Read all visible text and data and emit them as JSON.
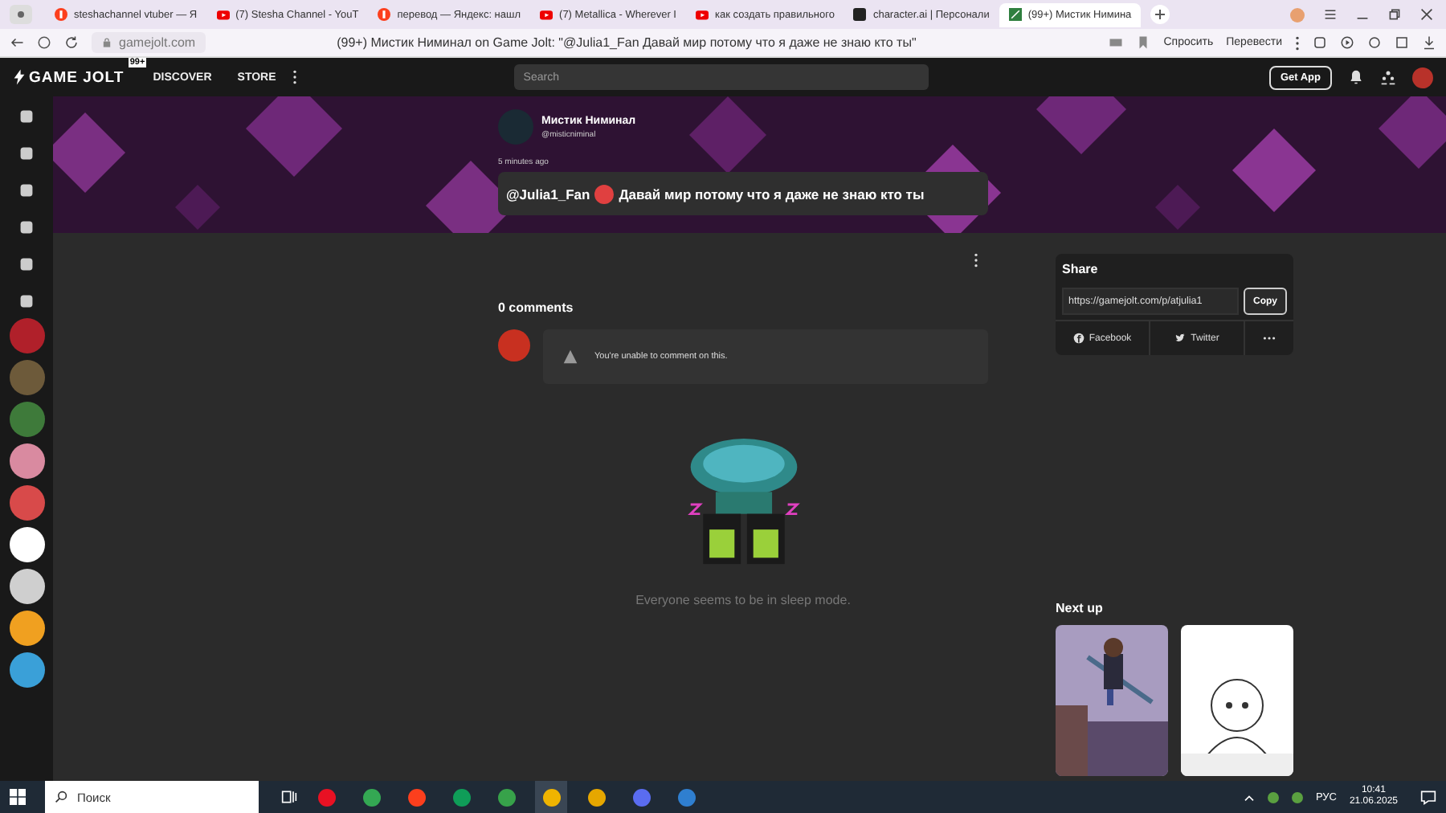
{
  "browser": {
    "tabs": [
      {
        "kind": "yandex",
        "title": "steshachannel vtuber — Я",
        "selected": false
      },
      {
        "kind": "youtube",
        "title": "(7) Stesha Channel - YouT",
        "selected": false
      },
      {
        "kind": "yandex",
        "title": "перевод — Яндекс: нашл",
        "selected": false
      },
      {
        "kind": "youtube",
        "title": "(7) Metallica - Wherever I",
        "selected": false
      },
      {
        "kind": "youtube",
        "title": "как создать правильного",
        "selected": false
      },
      {
        "kind": "character",
        "title": "character.ai | Персонали",
        "selected": false
      },
      {
        "kind": "gamejolt",
        "title": "(99+) Мистик Нимина",
        "selected": true
      }
    ],
    "address": "gamejolt.com",
    "page_title": "(99+) Мистик Ниминал on Game Jolt: \"@Julia1_Fan Давай мир потому что я даже не знаю кто ты\"",
    "actions": [
      "Спросить",
      "Перевести"
    ]
  },
  "header": {
    "logo": "GAME JOLT",
    "badge": "99+",
    "nav": [
      "DISCOVER",
      "STORE"
    ],
    "search_placeholder": "Search",
    "get_app": "Get App"
  },
  "sidebar": {
    "communities": [
      {
        "color": "#b0202a"
      },
      {
        "color": "#6d5a3a"
      },
      {
        "color": "#3e7a3a"
      },
      {
        "color": "#d98aa0"
      },
      {
        "color": "#d84a4a"
      },
      {
        "color": "#ffffff"
      },
      {
        "color": "#cfcfcf"
      },
      {
        "color": "#f0a020"
      },
      {
        "color": "#3aa0d8"
      }
    ]
  },
  "post": {
    "author": "Мистик Ниминал",
    "handle": "@misticniminal",
    "time": "5 minutes ago",
    "mention": "@Julia1_Fan",
    "text": "Давай мир потому что я даже не знаю кто ты"
  },
  "comments": {
    "count": "0 comments",
    "notice": "You're unable to comment on this.",
    "empty": "Everyone seems to be in sleep mode."
  },
  "share": {
    "title": "Share",
    "url": "https://gamejolt.com/p/atjulia1",
    "copy": "Copy",
    "networks": [
      {
        "kind": "facebook",
        "label": "Facebook"
      },
      {
        "kind": "twitter",
        "label": "Twitter"
      }
    ]
  },
  "next_up": {
    "title": "Next up"
  },
  "taskbar": {
    "search": "Поиск",
    "lang": "РУС",
    "time": "10:41",
    "date": "21.06.2025"
  }
}
